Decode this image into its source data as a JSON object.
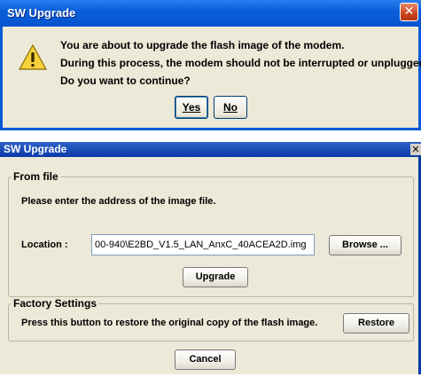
{
  "confirm": {
    "title": "SW Upgrade",
    "close_glyph": "✕",
    "lines": [
      "You are about to upgrade the flash image of the modem.",
      "During this process, the modem should not be interrupted or unplugged.",
      "Do you want to continue?"
    ],
    "icon": "warning-icon",
    "yes_label": "Yes",
    "no_label": "No"
  },
  "upgrade": {
    "title": "SW Upgrade",
    "close_glyph": "✕",
    "from_file": {
      "legend": "From file",
      "instruction": "Please enter the address of the image file.",
      "location_label": "Location :",
      "location_value": "00-940\\E2BD_V1.5_LAN_AnxC_40ACEA2D.img",
      "browse_label": "Browse ...",
      "upgrade_label": "Upgrade"
    },
    "factory": {
      "legend": "Factory Settings",
      "description": "Press this button to restore the original copy of the flash image.",
      "restore_label": "Restore"
    },
    "cancel_label": "Cancel"
  }
}
